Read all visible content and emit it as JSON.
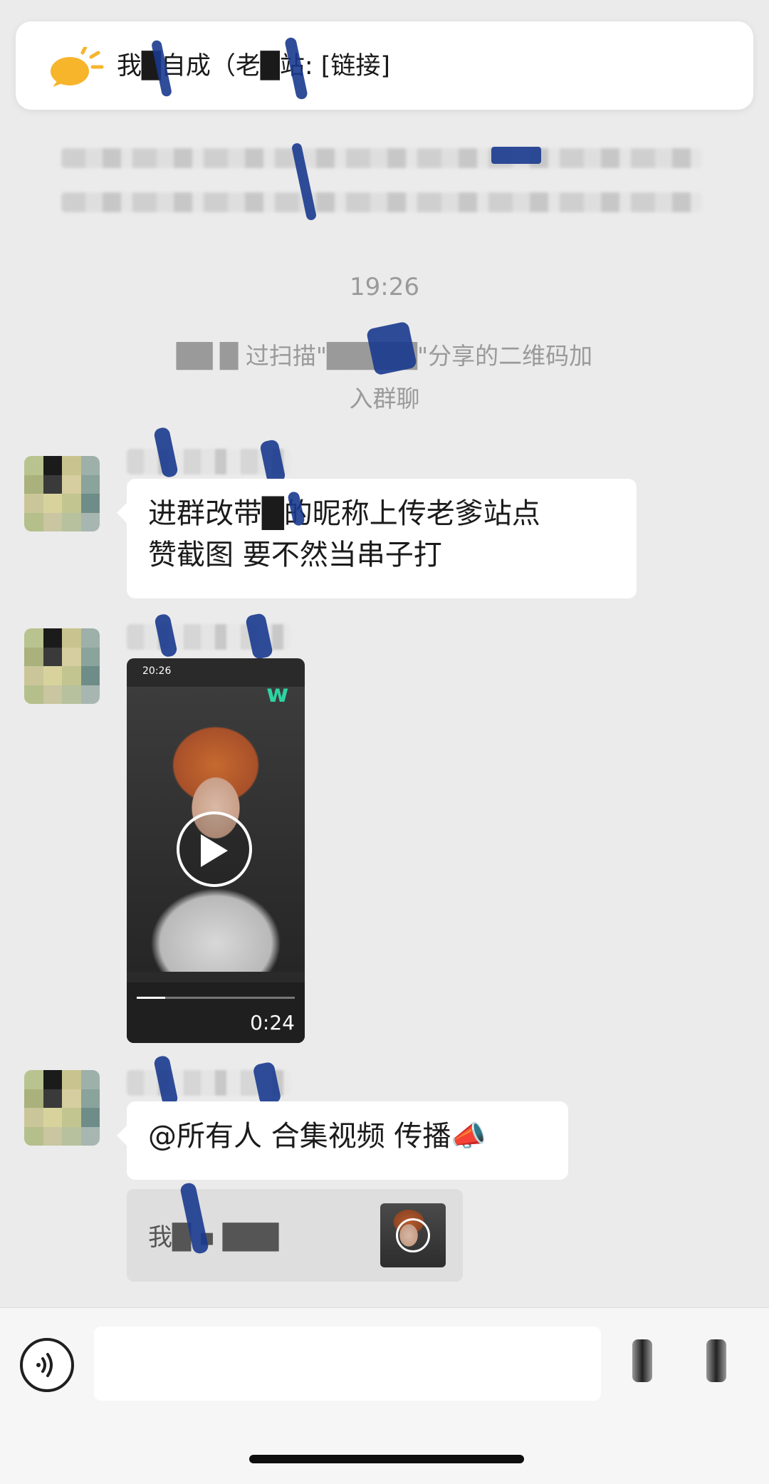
{
  "pinned": {
    "icon": "announcement-bubble-icon",
    "text": "我█自成（老█站: [链接]"
  },
  "system": {
    "time": "19:26",
    "join_text_line1": "██ █ 过扫描\"█████\"分享的二维码加",
    "join_text_line2": "入群聊"
  },
  "messages": [
    {
      "type": "text",
      "lines": [
        "进群改带█的昵称上传老爹站点",
        "赞截图 要不然当串子打"
      ]
    },
    {
      "type": "video",
      "duration": "0:24",
      "status_time": "20:26"
    },
    {
      "type": "text",
      "lines": [
        "@所有人 合集视频 传播📣"
      ]
    },
    {
      "type": "quote",
      "text": "我█ ▪ ███"
    }
  ],
  "input_bar": {
    "voice_icon": "voice-input-icon",
    "placeholder": ""
  },
  "colors": {
    "background": "#ebebeb",
    "bubble": "#ffffff",
    "pinned_icon": "#f7b52c"
  }
}
